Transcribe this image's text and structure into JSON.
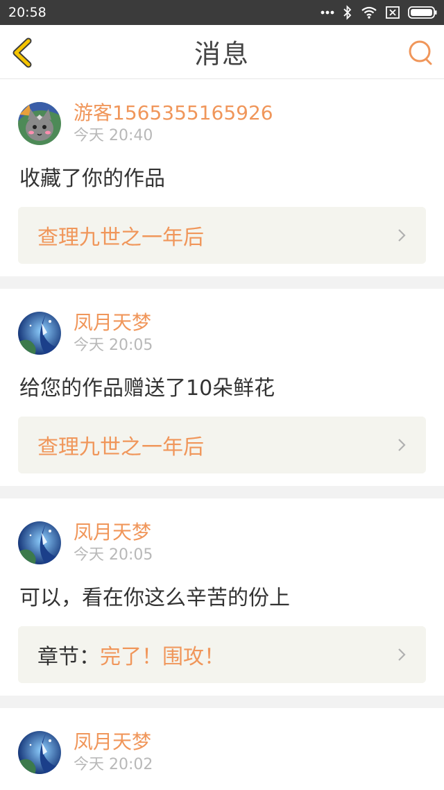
{
  "status_bar": {
    "time": "20:58"
  },
  "header": {
    "title": "消息"
  },
  "messages": [
    {
      "user": "游客1565355165926",
      "time": "今天 20:40",
      "text": "收藏了你的作品",
      "link_prefix": "",
      "link_title": "查理九世之一年后",
      "avatar": "grey-cat-avatar"
    },
    {
      "user": "凤月天梦",
      "time": "今天 20:05",
      "text": "给您的作品赠送了10朵鲜花",
      "link_prefix": "",
      "link_title": "查理九世之一年后",
      "avatar": "blue-night-avatar"
    },
    {
      "user": "凤月天梦",
      "time": "今天 20:05",
      "text": "可以，看在你这么辛苦的份上",
      "link_prefix": "章节：",
      "link_title": "完了！围攻！",
      "avatar": "blue-night-avatar"
    },
    {
      "user": "凤月天梦",
      "time": "今天 20:02",
      "text": "",
      "link_prefix": "",
      "link_title": "",
      "avatar": "blue-night-avatar"
    }
  ],
  "colors": {
    "accent": "#f0965a",
    "link_bg": "#f4f4ee",
    "back_icon": "#f5c400",
    "status_bar": "#3b3b3b"
  }
}
